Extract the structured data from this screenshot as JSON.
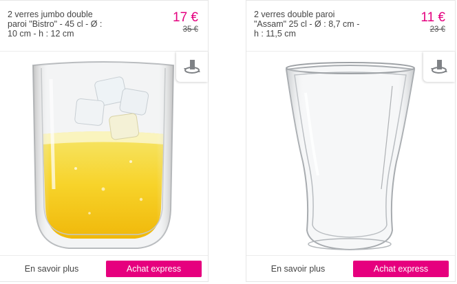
{
  "products": [
    {
      "title_lines": [
        "2 verres jumbo double",
        "paroi \"Bistro\" - 45 cl - Ø :",
        "10 cm - h : 12 cm"
      ],
      "price": "17 €",
      "old_price": "35 €",
      "more_label": "En savoir plus",
      "express_label": "Achat express",
      "image_icon": "double-wall-glass-with-drink-image",
      "view_icon": "rotate-360-icon"
    },
    {
      "title_lines": [
        "2 verres double paroi",
        "\"Assam\" 25 cl - Ø : 8,7 cm -",
        "h : 11,5 cm"
      ],
      "price": "11 €",
      "old_price": "23 €",
      "more_label": "En savoir plus",
      "express_label": "Achat express",
      "image_icon": "double-wall-glass-empty-image",
      "view_icon": "rotate-360-icon"
    }
  ],
  "colors": {
    "accent": "#e6007e",
    "price": "#e4007f",
    "text": "#444444",
    "border": "#e6e6e6"
  }
}
